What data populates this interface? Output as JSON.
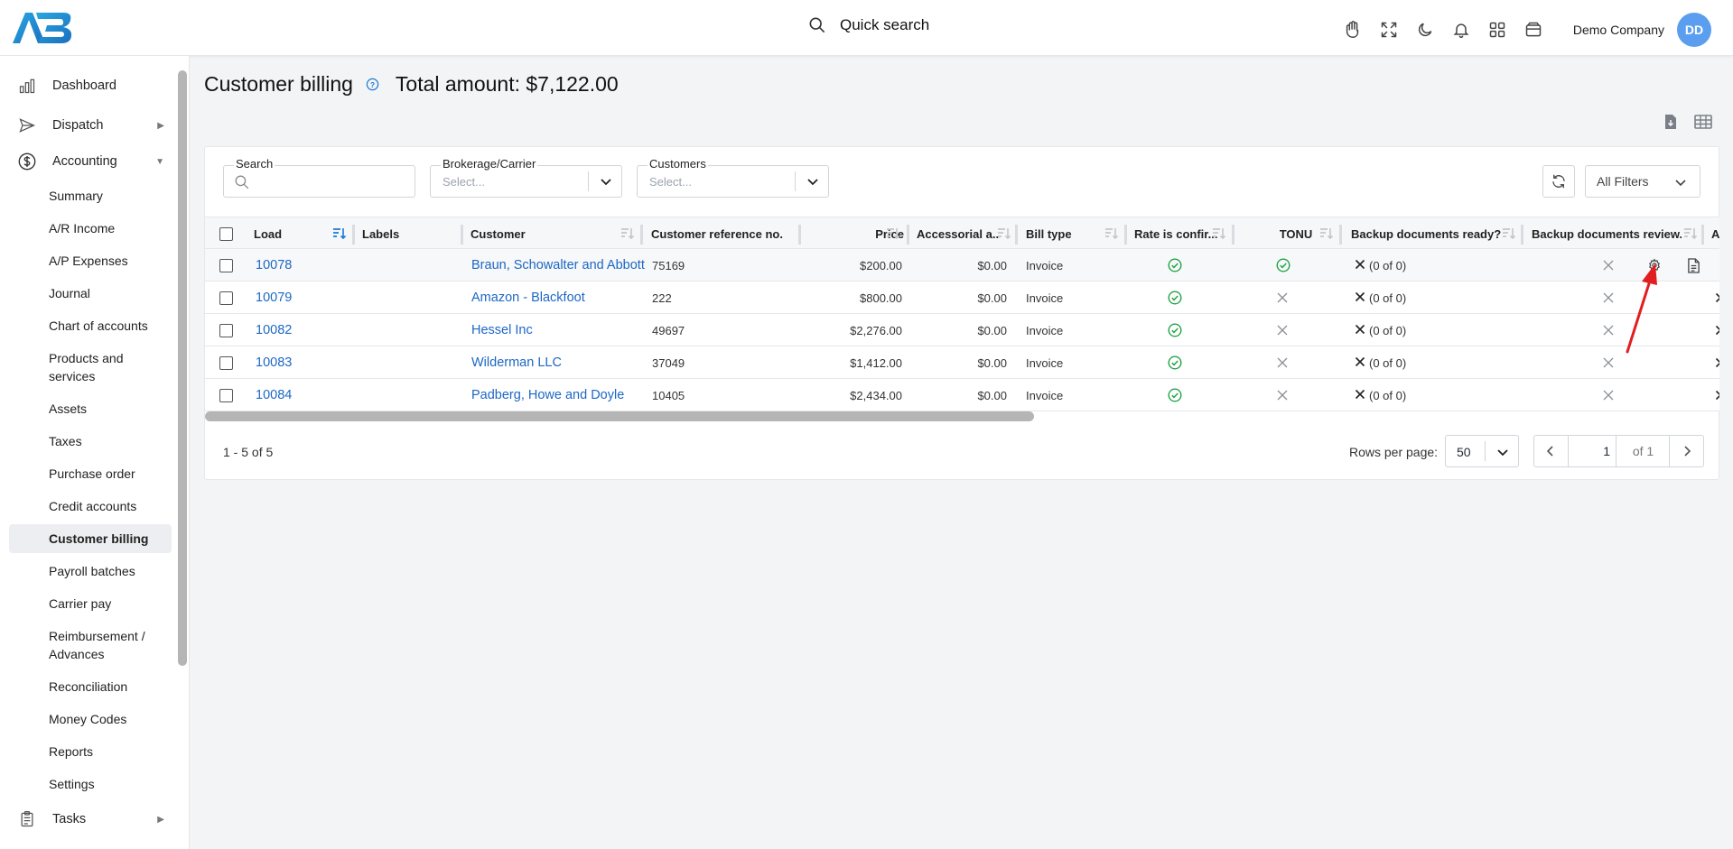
{
  "header": {
    "quick_search": "Quick search",
    "company": "Demo Company",
    "avatar_initials": "DD",
    "icons": [
      "hand-icon",
      "fullscreen-icon",
      "moon-icon",
      "bell-icon",
      "apps-grid-icon",
      "wallet-icon"
    ]
  },
  "sidebar": {
    "top": [
      {
        "label": "Dashboard",
        "icon": "chart-bar-icon"
      },
      {
        "label": "Dispatch",
        "icon": "paper-plane-icon"
      },
      {
        "label": "Accounting",
        "icon": "dollar-circle-icon"
      }
    ],
    "accounting_items": [
      "Summary",
      "A/R Income",
      "A/P Expenses",
      "Journal",
      "Chart of accounts",
      "Products and services",
      "Assets",
      "Taxes",
      "Purchase order",
      "Credit accounts",
      "Customer billing",
      "Payroll batches",
      "Carrier pay",
      "Reimbursement / Advances",
      "Reconciliation",
      "Money Codes",
      "Reports",
      "Settings"
    ],
    "tasks": {
      "label": "Tasks",
      "icon": "clipboard-icon"
    }
  },
  "page": {
    "title": "Customer billing",
    "total": "Total amount: $7,122.00"
  },
  "filters": {
    "search_label": "Search",
    "brokerage_label": "Brokerage/Carrier",
    "brokerage_placeholder": "Select...",
    "customers_label": "Customers",
    "customers_placeholder": "Select...",
    "all_filters": "All Filters"
  },
  "table": {
    "columns": [
      "Load",
      "Labels",
      "Customer",
      "Customer reference no.",
      "Price",
      "Accessorial a...",
      "Bill type",
      "Rate is confir...",
      "TONU",
      "Backup documents ready?",
      "Backup documents review...",
      "A"
    ],
    "rows": [
      {
        "load": "10078",
        "labels": "",
        "customer": "Braun, Schowalter and Abbott",
        "ref": "75169",
        "price": "$200.00",
        "accessorial": "$0.00",
        "bill_type": "Invoice",
        "rate_confirmed": true,
        "tonu": true,
        "backup_ready": "(0 of 0)",
        "backup_reviewed": false
      },
      {
        "load": "10079",
        "labels": "",
        "customer": "Amazon - Blackfoot",
        "ref": "222",
        "price": "$800.00",
        "accessorial": "$0.00",
        "bill_type": "Invoice",
        "rate_confirmed": true,
        "tonu": false,
        "backup_ready": "(0 of 0)",
        "backup_reviewed": false
      },
      {
        "load": "10082",
        "labels": "",
        "customer": "Hessel Inc",
        "ref": "49697",
        "price": "$2,276.00",
        "accessorial": "$0.00",
        "bill_type": "Invoice",
        "rate_confirmed": true,
        "tonu": false,
        "backup_ready": "(0 of 0)",
        "backup_reviewed": false
      },
      {
        "load": "10083",
        "labels": "",
        "customer": "Wilderman LLC",
        "ref": "37049",
        "price": "$1,412.00",
        "accessorial": "$0.00",
        "bill_type": "Invoice",
        "rate_confirmed": true,
        "tonu": false,
        "backup_ready": "(0 of 0)",
        "backup_reviewed": false
      },
      {
        "load": "10084",
        "labels": "",
        "customer": "Padberg, Howe and Doyle",
        "ref": "10405",
        "price": "$2,434.00",
        "accessorial": "$0.00",
        "bill_type": "Invoice",
        "rate_confirmed": true,
        "tonu": false,
        "backup_ready": "(0 of 0)",
        "backup_reviewed": false
      }
    ]
  },
  "footer": {
    "range": "1 - 5 of 5",
    "rows_per_page_label": "Rows per page:",
    "rows_per_page": "50",
    "page": "1",
    "of_pages": "of 1"
  },
  "colors": {
    "link": "#1d67c4",
    "success": "#22a447",
    "avatar": "#5b9ef0",
    "annotation": "#e02020"
  }
}
